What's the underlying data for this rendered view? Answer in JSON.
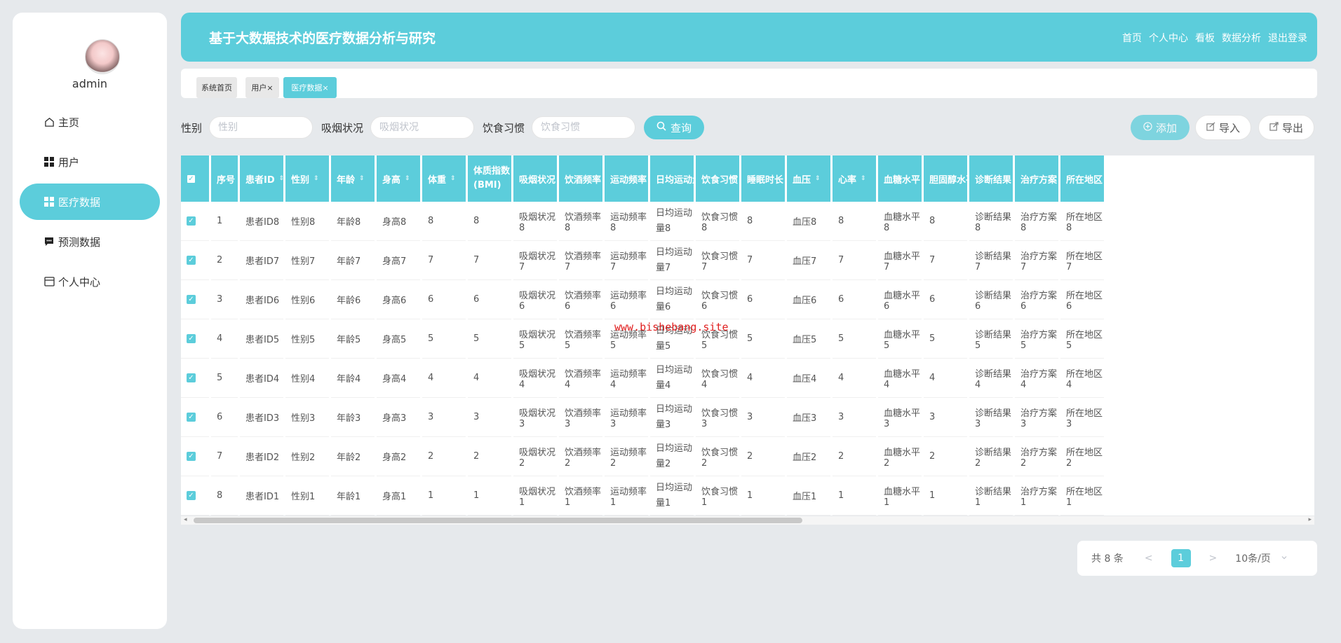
{
  "sidebar": {
    "user": "admin",
    "items": [
      {
        "label": "主页",
        "icon": "home-icon"
      },
      {
        "label": "用户",
        "icon": "grid-icon"
      },
      {
        "label": "医疗数据",
        "icon": "grid-icon"
      },
      {
        "label": "预测数据",
        "icon": "chat-icon"
      },
      {
        "label": "个人中心",
        "icon": "card-icon"
      }
    ],
    "active_index": 2
  },
  "header": {
    "title": "基于大数据技术的医疗数据分析与研究",
    "nav": [
      "首页",
      "个人中心",
      "看板",
      "数据分析",
      "退出登录"
    ]
  },
  "tabs": {
    "home": "系统首页",
    "user": "用户",
    "medical": "医疗数据",
    "close": "×"
  },
  "search": {
    "gender_label": "性别",
    "gender_placeholder": "性别",
    "smoking_label": "吸烟状况",
    "smoking_placeholder": "吸烟状况",
    "diet_label": "饮食习惯",
    "diet_placeholder": "饮食习惯",
    "query_label": "查询"
  },
  "actions": {
    "add": "添加",
    "import": "导入",
    "export": "导出"
  },
  "table": {
    "columns": [
      "序号",
      "患者ID",
      "性别",
      "年龄",
      "身高",
      "体重",
      "体质指数(BMI)",
      "吸烟状况",
      "饮酒频率",
      "运动频率",
      "日均运动量",
      "饮食习惯",
      "睡眠时长",
      "血压",
      "心率",
      "血糖水平",
      "胆固醇水平",
      "诊断结果",
      "治疗方案",
      "所在地区"
    ],
    "rows": [
      [
        "1",
        "患者ID8",
        "性别8",
        "年龄8",
        "身高8",
        "8",
        "8",
        "吸烟状况8",
        "饮酒频率8",
        "运动频率8",
        "日均运动量8",
        "饮食习惯8",
        "8",
        "血压8",
        "8",
        "血糖水平8",
        "8",
        "诊断结果8",
        "治疗方案8",
        "所在地区8"
      ],
      [
        "2",
        "患者ID7",
        "性别7",
        "年龄7",
        "身高7",
        "7",
        "7",
        "吸烟状况7",
        "饮酒频率7",
        "运动频率7",
        "日均运动量7",
        "饮食习惯7",
        "7",
        "血压7",
        "7",
        "血糖水平7",
        "7",
        "诊断结果7",
        "治疗方案7",
        "所在地区7"
      ],
      [
        "3",
        "患者ID6",
        "性别6",
        "年龄6",
        "身高6",
        "6",
        "6",
        "吸烟状况6",
        "饮酒频率6",
        "运动频率6",
        "日均运动量6",
        "饮食习惯6",
        "6",
        "血压6",
        "6",
        "血糖水平6",
        "6",
        "诊断结果6",
        "治疗方案6",
        "所在地区6"
      ],
      [
        "4",
        "患者ID5",
        "性别5",
        "年龄5",
        "身高5",
        "5",
        "5",
        "吸烟状况5",
        "饮酒频率5",
        "运动频率5",
        "日均运动量5",
        "饮食习惯5",
        "5",
        "血压5",
        "5",
        "血糖水平5",
        "5",
        "诊断结果5",
        "治疗方案5",
        "所在地区5"
      ],
      [
        "5",
        "患者ID4",
        "性别4",
        "年龄4",
        "身高4",
        "4",
        "4",
        "吸烟状况4",
        "饮酒频率4",
        "运动频率4",
        "日均运动量4",
        "饮食习惯4",
        "4",
        "血压4",
        "4",
        "血糖水平4",
        "4",
        "诊断结果4",
        "治疗方案4",
        "所在地区4"
      ],
      [
        "6",
        "患者ID3",
        "性别3",
        "年龄3",
        "身高3",
        "3",
        "3",
        "吸烟状况3",
        "饮酒频率3",
        "运动频率3",
        "日均运动量3",
        "饮食习惯3",
        "3",
        "血压3",
        "3",
        "血糖水平3",
        "3",
        "诊断结果3",
        "治疗方案3",
        "所在地区3"
      ],
      [
        "7",
        "患者ID2",
        "性别2",
        "年龄2",
        "身高2",
        "2",
        "2",
        "吸烟状况2",
        "饮酒频率2",
        "运动频率2",
        "日均运动量2",
        "饮食习惯2",
        "2",
        "血压2",
        "2",
        "血糖水平2",
        "2",
        "诊断结果2",
        "治疗方案2",
        "所在地区2"
      ],
      [
        "8",
        "患者ID1",
        "性别1",
        "年龄1",
        "身高1",
        "1",
        "1",
        "吸烟状况1",
        "饮酒频率1",
        "运动频率1",
        "日均运动量1",
        "饮食习惯1",
        "1",
        "血压1",
        "1",
        "血糖水平1",
        "1",
        "诊断结果1",
        "治疗方案1",
        "所在地区1"
      ]
    ]
  },
  "watermark": "www.bishebang.site",
  "pagination": {
    "total": "共 8 条",
    "prev": "<",
    "current": "1",
    "next": ">",
    "page_size": "10条/页"
  },
  "colors": {
    "accent": "#5ccddb",
    "background": "#e6e9ec"
  }
}
